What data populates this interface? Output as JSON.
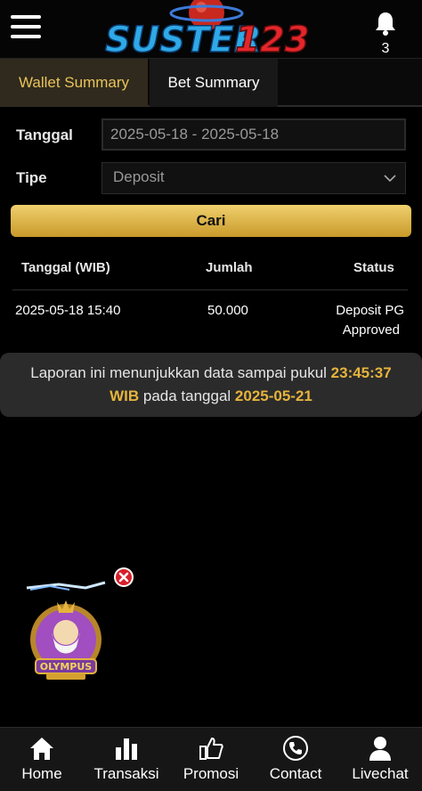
{
  "header": {
    "logo_text": "SUSTER123",
    "notification_count": "3"
  },
  "tabs": [
    {
      "label": "Wallet Summary",
      "active": true
    },
    {
      "label": "Bet Summary",
      "active": false
    }
  ],
  "filter": {
    "date_label": "Tanggal",
    "date_value": "2025-05-18 - 2025-05-18",
    "type_label": "Tipe",
    "type_value": "Deposit",
    "search_button": "Cari"
  },
  "table": {
    "headers": [
      "Tanggal (WIB)",
      "Jumlah",
      "Status"
    ],
    "rows": [
      {
        "date": "2025-05-18 15:40",
        "amount": "50.000",
        "status_line1": "Deposit PG",
        "status_line2": "Approved"
      }
    ]
  },
  "notice": {
    "text1": "Laporan ini menunjukkan data sampai pukul ",
    "time": "23:45:37",
    "tz": "WIB",
    "text2": " pada tanggal ",
    "date": "2025-05-21"
  },
  "promo": {
    "game_title": "OLYMPUS"
  },
  "bottom_nav": [
    {
      "label": "Home",
      "icon": "home-icon"
    },
    {
      "label": "Transaksi",
      "icon": "bar-chart-icon"
    },
    {
      "label": "Promosi",
      "icon": "thumbs-up-icon"
    },
    {
      "label": "Contact",
      "icon": "phone-icon"
    },
    {
      "label": "Livechat",
      "icon": "user-icon"
    }
  ],
  "colors": {
    "accent_gold": "#e6b43c",
    "active_tab_bg": "#2f2a1d",
    "nav_bg": "#161616"
  }
}
